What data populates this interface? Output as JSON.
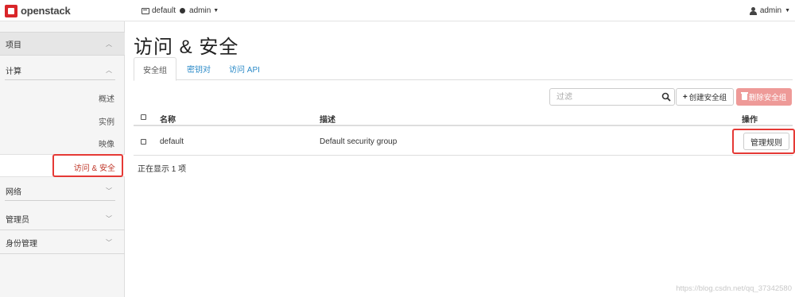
{
  "header": {
    "logo_text": "openstack",
    "project_domain": "default",
    "project_name": "admin",
    "user_name": "admin"
  },
  "sidebar": {
    "project_label": "项目",
    "compute_label": "计算",
    "compute_items": [
      {
        "label": "概述"
      },
      {
        "label": "实例"
      },
      {
        "label": "映像"
      },
      {
        "label": "访问 & 安全",
        "active": true
      }
    ],
    "groups": [
      {
        "label": "网络"
      },
      {
        "label": "管理员"
      },
      {
        "label": "身份管理"
      }
    ]
  },
  "main": {
    "title": "访问 & 安全",
    "tabs": [
      {
        "label": "安全组",
        "active": true
      },
      {
        "label": "密钥对"
      },
      {
        "label": "访问 API"
      }
    ],
    "toolbar": {
      "filter_placeholder": "过滤",
      "create_label": "创建安全组",
      "delete_label": "删除安全组"
    },
    "table": {
      "columns": [
        "名称",
        "描述",
        "操作"
      ],
      "rows": [
        {
          "name": "default",
          "description": "Default security group",
          "action": "管理规则"
        }
      ],
      "count_text": "正在显示 1 项"
    }
  },
  "watermark": "https://blog.csdn.net/qq_37342580",
  "colors": {
    "accent_red": "#d9262a",
    "link_blue": "#2a8ac8",
    "highlight": "#e53935",
    "delete_button": "#ee9a98"
  }
}
